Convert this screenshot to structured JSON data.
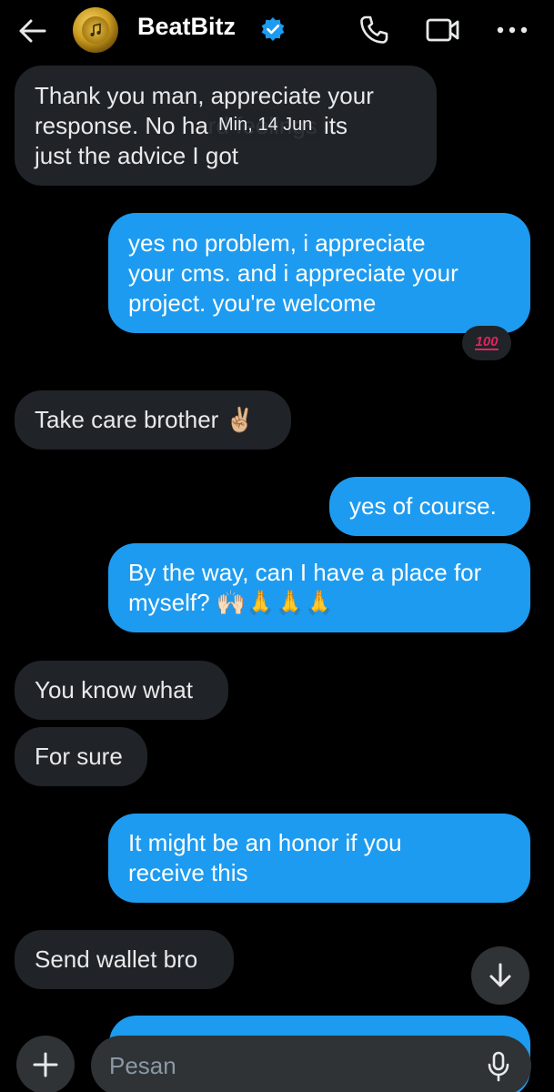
{
  "header": {
    "title": "BeatBitz",
    "icons": {
      "back": "back-arrow-icon",
      "verified": "verified-badge-icon",
      "call": "phone-icon",
      "video": "video-camera-icon",
      "more": "more-dots-icon"
    }
  },
  "date_divider": "Min, 14 Jun",
  "messages": [
    {
      "side": "in",
      "text": "Thank you man, appreciate your\nresponse. No hard feelings its\njust the advice I got"
    },
    {
      "side": "out",
      "text": "yes no problem, i appreciate\nyour cms. and i appreciate your\nproject. you're welcome",
      "reaction": "100"
    },
    {
      "side": "in",
      "text": "Take care brother ✌🏼"
    },
    {
      "side": "out",
      "text": "yes of course."
    },
    {
      "side": "out",
      "text": "By the way, can I have a place for\nmyself? 🙌🏻🙏🙏🙏"
    },
    {
      "side": "in",
      "text": "You know what"
    },
    {
      "side": "in",
      "text": "For sure"
    },
    {
      "side": "out",
      "text": "It might be an honor if you\nreceive this"
    },
    {
      "side": "in",
      "text": "Send wallet bro"
    }
  ],
  "composer": {
    "placeholder": "Pesan",
    "icons": {
      "add": "plus-icon",
      "mic": "microphone-icon",
      "scroll": "arrow-down-icon"
    }
  },
  "colors": {
    "background": "#000000",
    "incoming_bubble": "#202327",
    "outgoing_bubble": "#1d9bf0",
    "verified": "#1d9bf0",
    "reaction_text": "#e0245e"
  }
}
